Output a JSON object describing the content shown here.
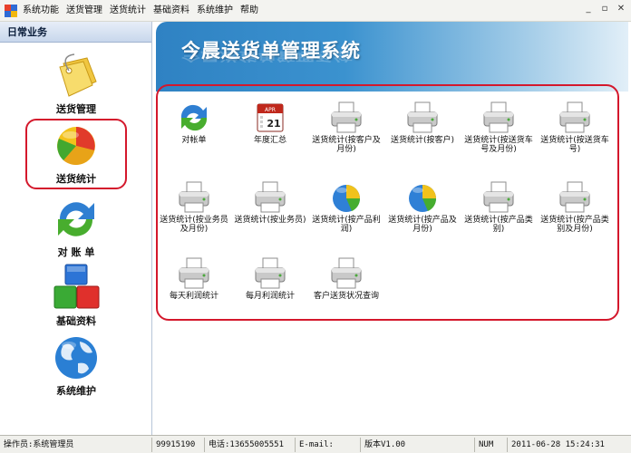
{
  "menubar": {
    "items": [
      "系统功能",
      "送货管理",
      "送货统计",
      "基础资料",
      "系统维护",
      "帮助"
    ]
  },
  "window_controls": {
    "minimize": "_",
    "restore": "▫",
    "close": "✕"
  },
  "sidebar": {
    "header": "日常业务",
    "items": [
      {
        "label": "送货管理",
        "icon": "tag-icon"
      },
      {
        "label": "送货统计",
        "icon": "pie-chart-icon",
        "active": true
      },
      {
        "label": "对 账 单",
        "icon": "refresh-icon"
      },
      {
        "label": "基础资料",
        "icon": "blocks-icon"
      },
      {
        "label": "系统维护",
        "icon": "globe-icon"
      }
    ]
  },
  "banner": {
    "title": "今晨送货单管理系统"
  },
  "functions": [
    {
      "label": "对帐单",
      "icon": "refresh-icon"
    },
    {
      "label": "年度汇总",
      "icon": "calendar-icon",
      "calendar_month": "APR",
      "calendar_day": "21"
    },
    {
      "label": "送货统计(按客户及月份)",
      "icon": "printer-icon"
    },
    {
      "label": "送货统计(按客户)",
      "icon": "printer-icon"
    },
    {
      "label": "送货统计(按送货车号及月份)",
      "icon": "printer-icon"
    },
    {
      "label": "送货统计(按送货车号)",
      "icon": "printer-icon"
    },
    {
      "label": "送货统计(按业务员及月份)",
      "icon": "printer-icon"
    },
    {
      "label": "送货统计(按业务员)",
      "icon": "printer-icon"
    },
    {
      "label": "送货统计(按产品利润)",
      "icon": "pie-chart-icon"
    },
    {
      "label": "送货统计(按产品及月份)",
      "icon": "pie-chart-icon"
    },
    {
      "label": "送货统计(按产品类别)",
      "icon": "printer-icon"
    },
    {
      "label": "送货统计(按产品类别及月份)",
      "icon": "printer-icon"
    },
    {
      "label": "每天利润统计",
      "icon": "printer-icon"
    },
    {
      "label": "每月利润统计",
      "icon": "printer-icon"
    },
    {
      "label": "客户送货状况查询",
      "icon": "printer-icon"
    }
  ],
  "statusbar": {
    "operator": "操作员:系统管理员",
    "phone1": "99915190",
    "phone2": "电话:13655005551",
    "email": "E-mail:",
    "version": "版本V1.00",
    "num": "NUM",
    "datetime": "2011-06-28 15:24:31"
  },
  "colors": {
    "highlight_border": "#d4182c",
    "banner_blue": "#2f82c3"
  }
}
